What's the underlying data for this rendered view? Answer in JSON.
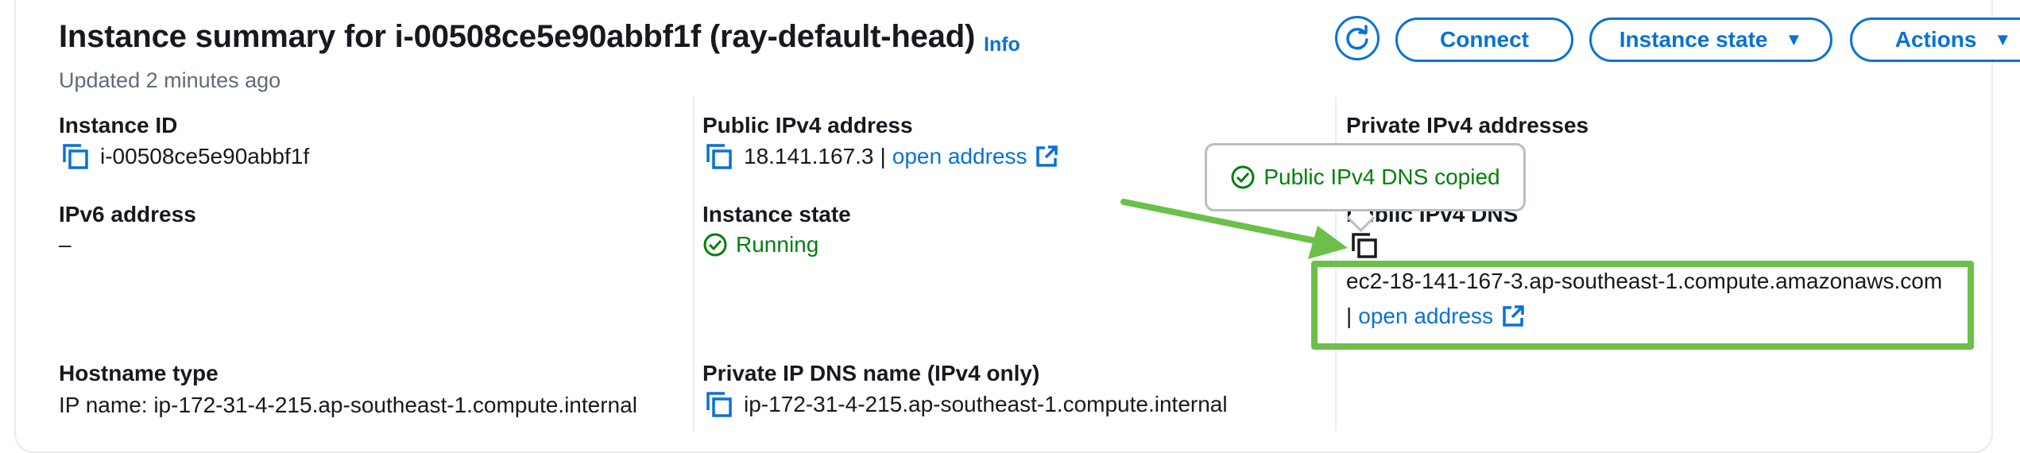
{
  "header": {
    "title": "Instance summary for i-00508ce5e90abbf1f (ray-default-head)",
    "info_link": "Info",
    "updated": "Updated 2 minutes ago"
  },
  "toolbar": {
    "refresh_icon": "refresh-icon",
    "connect_label": "Connect",
    "instance_state_label": "Instance state",
    "actions_label": "Actions"
  },
  "columns": {
    "col1": {
      "instance_id_label": "Instance ID",
      "instance_id_value": "i-00508ce5e90abbf1f",
      "ipv6_label": "IPv6 address",
      "ipv6_value": "–",
      "hostname_type_label": "Hostname type",
      "hostname_type_value": "IP name: ip-172-31-4-215.ap-southeast-1.compute.internal"
    },
    "col2": {
      "public_ipv4_label": "Public IPv4 address",
      "public_ipv4_value": "18.141.167.3",
      "separator": "|",
      "open_address_link": "open address",
      "instance_state_label": "Instance state",
      "instance_state_value": "Running",
      "private_dns_label": "Private IP DNS name (IPv4 only)",
      "private_dns_value": "ip-172-31-4-215.ap-southeast-1.compute.internal"
    },
    "col3": {
      "private_ipv4_label": "Private IPv4 addresses",
      "public_dns_label": "Public IPv4 DNS",
      "public_dns_value": "ec2-18-141-167-3.ap-southeast-1.compute.amazonaws.com",
      "separator": "|",
      "open_address_link": "open address"
    }
  },
  "tooltip": {
    "text": "Public IPv4 DNS copied"
  },
  "colors": {
    "accent": "#0972d3",
    "success": "#037f0c",
    "annotation": "#6cc04a"
  }
}
